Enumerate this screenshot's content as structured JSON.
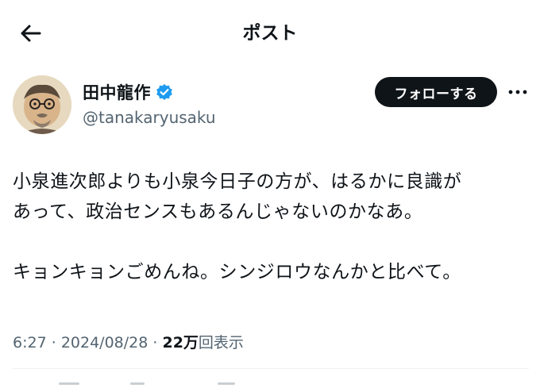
{
  "header": {
    "title": "ポスト",
    "back_icon": "arrow-left-icon"
  },
  "author": {
    "display_name": "田中龍作",
    "handle": "@tanakaryusaku",
    "verified": true,
    "verified_color": "#1d9bf0",
    "follow_label": "フォローする",
    "more_icon": "more-horizontal-icon"
  },
  "tweet": {
    "lines": [
      "小泉進次郎よりも小泉今日子の方が、はるかに良識が",
      "あって、政治センスもあるんじゃないのかなあ。",
      "",
      "キョンキョンごめんね。シンジロウなんかと比べて。"
    ]
  },
  "meta": {
    "time": "6:27",
    "date": "2024/08/28",
    "separator": "·",
    "views_count": "22万",
    "views_label": "回表示"
  },
  "colors": {
    "text": "#0f1419",
    "secondary": "#536471",
    "divider": "#eff3f4",
    "button_bg": "#0f1419"
  }
}
